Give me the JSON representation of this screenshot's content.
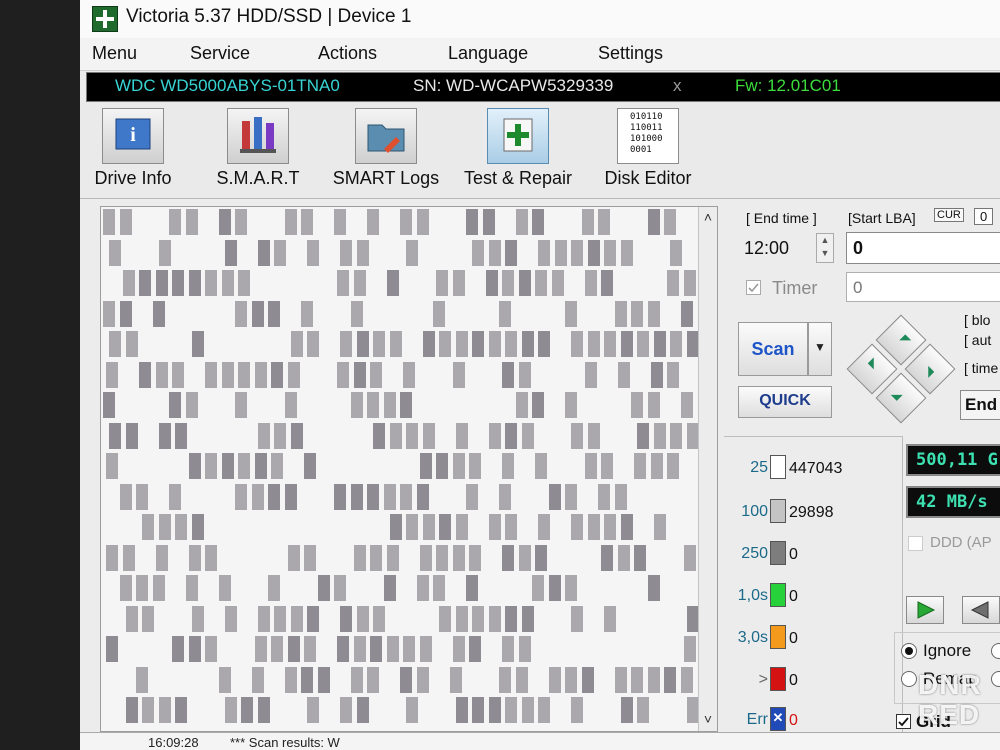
{
  "window": {
    "title": "Victoria 5.37 HDD/SSD | Device 1"
  },
  "menu": [
    "Menu",
    "Service",
    "Actions",
    "Language",
    "Settings"
  ],
  "device": {
    "model": "WDC WD5000ABYS-01TNA0",
    "serial": "SN: WD-WCAPW5329339",
    "close": "x",
    "firmware": "Fw: 12.01C01"
  },
  "toolbar": {
    "items": [
      {
        "label": "Drive Info",
        "icon": "info-icon"
      },
      {
        "label": "S.M.A.R.T",
        "icon": "smart-icon"
      },
      {
        "label": "SMART Logs",
        "icon": "logs-icon"
      },
      {
        "label": "Test & Repair",
        "icon": "plus-icon"
      },
      {
        "label": "Disk Editor",
        "icon": "binary-icon"
      }
    ],
    "active": "Test & Repair",
    "binary_text": [
      "010110",
      "110011",
      "101000",
      "0001"
    ]
  },
  "scan": {
    "end_time_label": "[ End time ]",
    "end_time": "12:00",
    "start_lba_label": "[Start LBA]",
    "cur_label": "CUR",
    "cur_value": "0",
    "start_lba": "0",
    "timer_label": "Timer",
    "timer_value": "0",
    "scan_label": "Scan",
    "quick_label": "QUICK",
    "side_labels": [
      "[ blo",
      "[ aut",
      "[ time"
    ],
    "end_label": "End"
  },
  "legend": [
    {
      "threshold": "25",
      "count": "447043",
      "color": "#ffffff"
    },
    {
      "threshold": "100",
      "count": "29898",
      "color": "#c4c4c4"
    },
    {
      "threshold": "250",
      "count": "0",
      "color": "#7d7d7d"
    },
    {
      "threshold": "1,0s",
      "count": "0",
      "color": "#26d13a"
    },
    {
      "threshold": "3,0s",
      "count": "0",
      "color": "#f39a1c"
    },
    {
      "threshold": ">",
      "count": "0",
      "color": "#d41212"
    },
    {
      "threshold": "Err",
      "count": "0",
      "color": "#1f4ab8"
    }
  ],
  "readouts": {
    "position": "500,11 G",
    "speed": "42 MB/s"
  },
  "options": {
    "ddd_label": "DDD (AP",
    "ignore_label": "Ignore",
    "remap_label": "Remap",
    "grid_label": "Grid"
  },
  "status": {
    "time": "16:09:28",
    "message": "*** Scan results: W"
  },
  "watermark": {
    "line1": "DNR",
    "line2": "RED"
  }
}
